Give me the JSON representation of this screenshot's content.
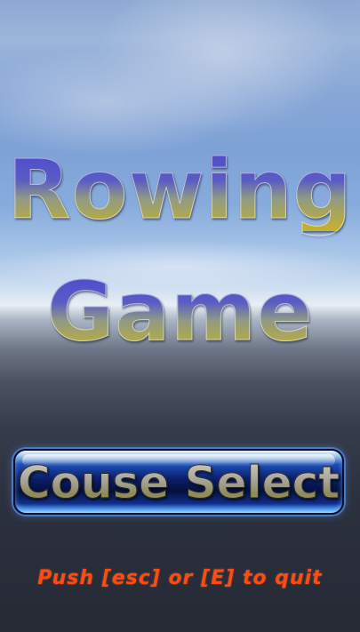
{
  "title": {
    "line1": "Rowing",
    "line2": "Game"
  },
  "menu": {
    "course_select_label": "Couse Select"
  },
  "hint": {
    "quit_text": "Push [esc] or [E] to quit"
  },
  "colors": {
    "title_top": "#4c4ad0",
    "title_bottom": "#c7b22a",
    "button_bg": "#0b1f6a",
    "hint_text": "#ff4a12"
  }
}
